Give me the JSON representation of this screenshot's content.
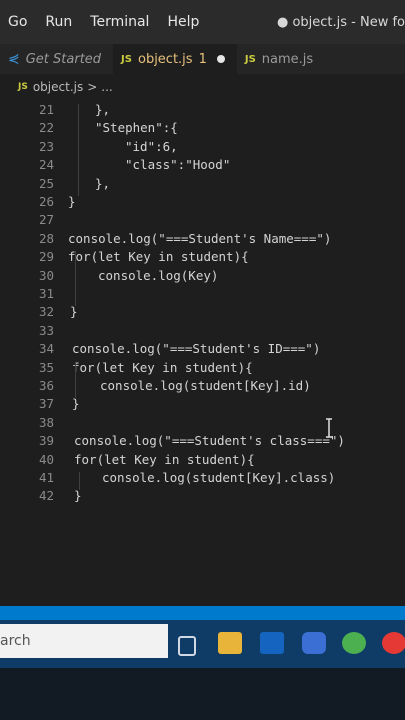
{
  "menu": [
    "Go",
    "Run",
    "Terminal",
    "Help"
  ],
  "window_title": "● object.js - New fo",
  "tabs": [
    {
      "label": "Get Started",
      "icon": "vscode-icon"
    },
    {
      "label": "object.js",
      "badge": "1",
      "modified": true,
      "icon": "js-icon"
    },
    {
      "label": "name.js",
      "icon": "js-icon"
    }
  ],
  "breadcrumb": {
    "file": "object.js",
    "sep": ">",
    "rest": "..."
  },
  "lines": [
    {
      "n": "21",
      "text": "},"
    },
    {
      "n": "22",
      "text": "\"Stephen\":{"
    },
    {
      "n": "23",
      "text": "\"id\":6,"
    },
    {
      "n": "24",
      "text": "\"class\":\"Hood\""
    },
    {
      "n": "25",
      "text": "},"
    },
    {
      "n": "26",
      "text": "}"
    },
    {
      "n": "27",
      "text": ""
    },
    {
      "n": "28",
      "text": "console.log(\"===Student's Name===\")"
    },
    {
      "n": "29",
      "text": "for(let Key in student){"
    },
    {
      "n": "30",
      "text": "console.log(Key)"
    },
    {
      "n": "31",
      "text": ""
    },
    {
      "n": "32",
      "text": "}"
    },
    {
      "n": "33",
      "text": ""
    },
    {
      "n": "34",
      "text": "console.log(\"===Student's ID===\")"
    },
    {
      "n": "35",
      "text": "for(let Key in student){"
    },
    {
      "n": "36",
      "text": "console.log(student[Key].id)"
    },
    {
      "n": "37",
      "text": "}"
    },
    {
      "n": "38",
      "text": ""
    },
    {
      "n": "39",
      "text": "console.log(\"===Student's class===\")"
    },
    {
      "n": "40",
      "text": "for(let Key in student){"
    },
    {
      "n": "41",
      "text": "console.log(student[Key].class)"
    },
    {
      "n": "42",
      "text": "}"
    }
  ],
  "taskbar": {
    "search_placeholder": "arch"
  },
  "colors": {
    "accent": "#007acc",
    "taskbar": "#0f3c66"
  }
}
